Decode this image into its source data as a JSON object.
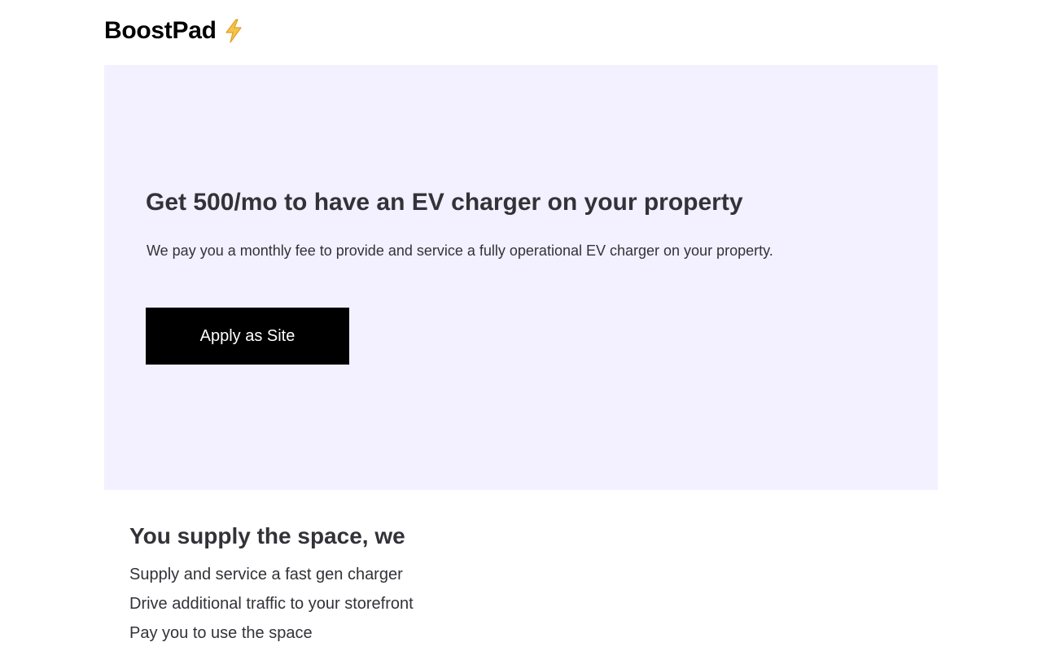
{
  "brand": {
    "name": "BoostPad",
    "icon": "lightning-bolt-icon",
    "icon_color": "#f6b93b"
  },
  "hero": {
    "title": "Get 500/mo to have an EV charger on your property",
    "subtitle": "We pay you a monthly fee to provide and service a fully operational EV charger on your property.",
    "button_label": "Apply as Site",
    "background": "#f3f0ff"
  },
  "benefits": {
    "title": "You supply the space, we",
    "items": [
      "Supply and service a fast gen charger",
      "Drive additional traffic to your storefront",
      "Pay you to use the space"
    ]
  }
}
